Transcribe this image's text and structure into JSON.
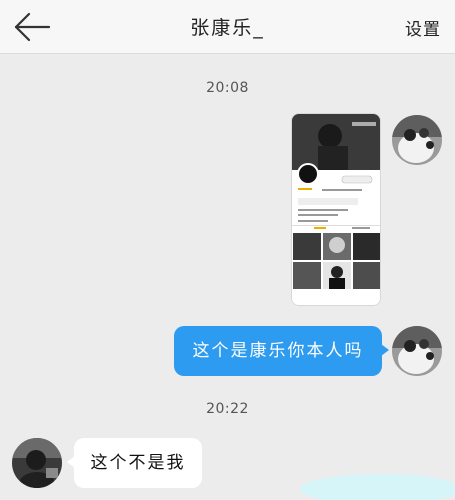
{
  "header": {
    "title": "张康乐_",
    "settings_label": "设置",
    "back_icon": "arrow-left-icon"
  },
  "messages": [
    {
      "type": "timestamp",
      "text": "20:08"
    },
    {
      "type": "image",
      "side": "right",
      "description_icon": "profile-screenshot-image"
    },
    {
      "type": "text",
      "side": "right",
      "text": "这个是康乐你本人吗"
    },
    {
      "type": "timestamp",
      "text": "20:22"
    },
    {
      "type": "text",
      "side": "left",
      "text": "这个不是我"
    }
  ],
  "colors": {
    "bubble_out": "#2d9bf0",
    "bubble_in": "#ffffff",
    "background": "#ececec"
  }
}
